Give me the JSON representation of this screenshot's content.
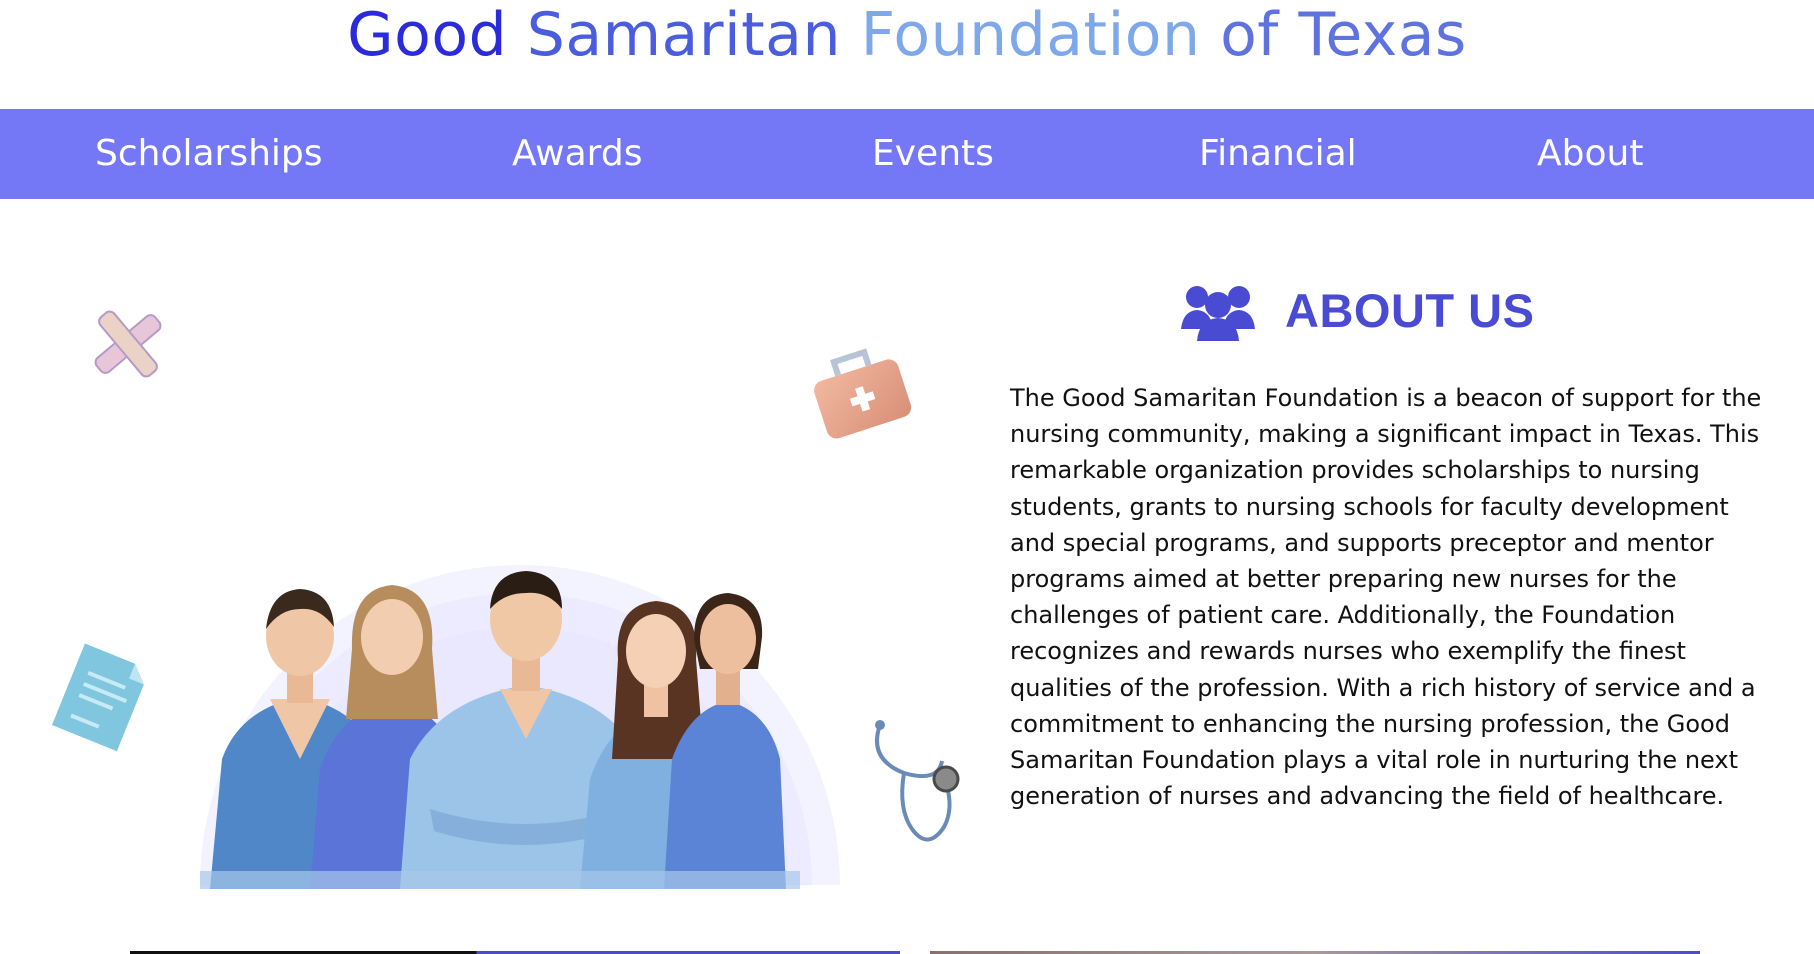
{
  "header": {
    "title_parts": [
      "Good",
      "Samaritan",
      "Foundation",
      "of Texas"
    ]
  },
  "nav": {
    "items": [
      {
        "label": "Scholarships"
      },
      {
        "label": "Awards"
      },
      {
        "label": "Events"
      },
      {
        "label": "Financial"
      },
      {
        "label": "About"
      }
    ]
  },
  "about": {
    "icon": "group-icon",
    "title": "ABOUT US",
    "body": "The Good Samaritan Foundation is a beacon of support for the nursing community, making a significant impact in Texas. This remarkable organization provides scholarships to nursing students, grants to nursing schools for faculty development and special programs, and supports preceptor and mentor programs aimed at better preparing new nurses for the challenges of patient care. Additionally, the Foundation recognizes and rewards nurses who exemplify the finest qualities of the profession. With a rich history of service and a commitment to enhancing the nursing profession, the Good Samaritan Foundation plays a vital role in nurturing the next generation of nurses and advancing the field of healthcare."
  },
  "colors": {
    "nav_bg": "#7478f6",
    "accent": "#4a4bd3",
    "title_dark": "#2b2bdc",
    "title_light": "#7ea8ea"
  },
  "illustration": {
    "icons": [
      "bandage-icon",
      "first-aid-kit-icon",
      "document-icon",
      "stethoscope-icon"
    ]
  }
}
